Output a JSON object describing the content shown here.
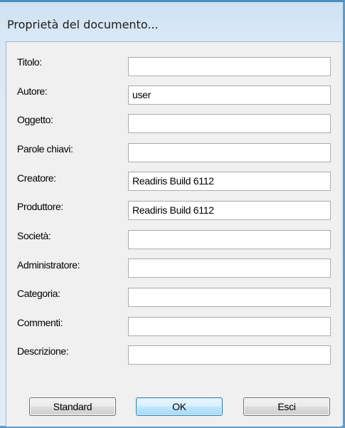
{
  "dialog": {
    "title": "Proprietà del documento..."
  },
  "fields": [
    {
      "label": "Titolo:",
      "value": ""
    },
    {
      "label": "Autore:",
      "value": "user"
    },
    {
      "label": "Oggetto:",
      "value": ""
    },
    {
      "label": "Parole chiavi:",
      "value": ""
    },
    {
      "label": "Creatore:",
      "value": "Readiris Build 6112"
    },
    {
      "label": "Produttore:",
      "value": "Readiris Build 6112"
    },
    {
      "label": "Società:",
      "value": ""
    },
    {
      "label": "Administratore:",
      "value": ""
    },
    {
      "label": "Categoria:",
      "value": ""
    },
    {
      "label": "Commenti:",
      "value": ""
    },
    {
      "label": "Descrizione:",
      "value": ""
    }
  ],
  "buttons": {
    "standard": "Standard",
    "ok": "OK",
    "cancel": "Esci"
  },
  "colors": {
    "title_bar_gradient_top": "#cde2f3",
    "client_background": "#f0f0f0",
    "default_button_border": "#3c7fb1"
  }
}
